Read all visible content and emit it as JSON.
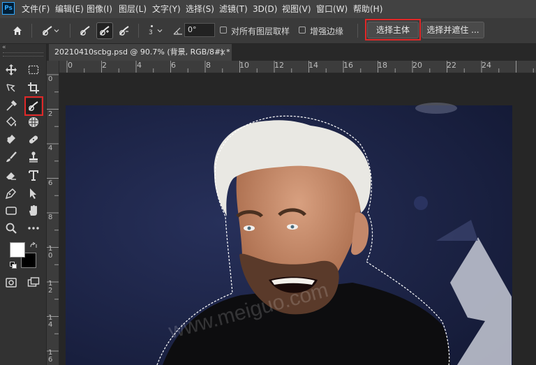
{
  "app": {
    "logo_text": "Ps",
    "accent": "#31a8ff"
  },
  "menu": [
    "文件(F)",
    "编辑(E)",
    "图像(I)",
    "图层(L)",
    "文字(Y)",
    "选择(S)",
    "滤镜(T)",
    "3D(D)",
    "视图(V)",
    "窗口(W)",
    "帮助(H)"
  ],
  "options": {
    "brush_size": "3",
    "angle_value": "0°",
    "sample_all_layers_label": "对所有图层取样",
    "sample_all_layers_checked": false,
    "enhance_edge_label": "增强边缘",
    "enhance_edge_checked": false,
    "select_subject_label": "选择主体",
    "select_mask_label": "选择并遮住 ...",
    "highlight_color": "#e02828"
  },
  "document": {
    "tab_title": "20210410scbg.psd @ 90.7% (背景, RGB/8#) *",
    "close_glyph": "×",
    "watermark": "www.meiguo.com"
  },
  "ruler": {
    "h_labels": [
      "0",
      "2",
      "4",
      "6",
      "8",
      "10",
      "12",
      "14",
      "16",
      "18",
      "20",
      "22",
      "24"
    ],
    "v_labels": [
      "0",
      "2",
      "4",
      "6",
      "8",
      "1\n0",
      "1\n2",
      "1\n4",
      "1\n6",
      "1\n8"
    ]
  },
  "tools": [
    "move-icon",
    "marquee-icon",
    "lasso-icon",
    "crop-icon",
    "eyedropper-icon",
    "quick-selection-icon",
    "paint-bucket-icon",
    "sphere-icon",
    "healing-brush-icon",
    "bandaid-icon",
    "brush-icon",
    "stamp-icon",
    "eraser-icon",
    "type-icon",
    "pen-icon",
    "path-selection-icon",
    "rectangle-icon",
    "hand-icon",
    "zoom-icon",
    "more-icon"
  ],
  "colors": {
    "foreground": "#ffffff",
    "background": "#000000"
  }
}
